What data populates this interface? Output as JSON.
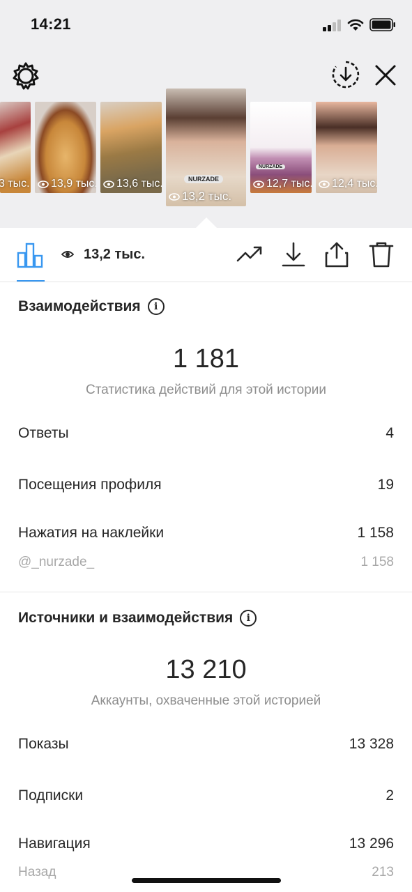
{
  "status_bar": {
    "time": "14:21"
  },
  "stories_strip": {
    "thumbs": [
      {
        "views": "3 тыс."
      },
      {
        "views": "13,9 тыс."
      },
      {
        "views": "13,6 тыс."
      },
      {
        "views": "13,2 тыс.",
        "sticker": "NURZADE"
      },
      {
        "views": "12,7 тыс.",
        "sticker": "NURZADE"
      },
      {
        "views": "12,4 тыс."
      }
    ]
  },
  "toolbar": {
    "view_count": "13,2 тыс."
  },
  "interactions": {
    "title": "Взаимодействия",
    "total": "1 181",
    "caption": "Статистика действий для этой истории",
    "rows": [
      {
        "label": "Ответы",
        "value": "4"
      },
      {
        "label": "Посещения профиля",
        "value": "19"
      },
      {
        "label": "Нажатия на наклейки",
        "value": "1 158"
      }
    ],
    "sub_row": {
      "label": "@_nurzade_",
      "value": "1 158"
    }
  },
  "discovery": {
    "title": "Источники и взаимодействия",
    "total": "13 210",
    "caption": "Аккаунты, охваченные этой историей",
    "rows": [
      {
        "label": "Показы",
        "value": "13 328"
      },
      {
        "label": "Подписки",
        "value": "2"
      },
      {
        "label": "Навигация",
        "value": "13 296"
      }
    ],
    "sub_row": {
      "label": "Назад",
      "value": "213"
    }
  },
  "colors": {
    "accent": "#3897f0",
    "text": "#262626",
    "muted": "#8e8e8e",
    "header_bg": "#efeff1"
  }
}
